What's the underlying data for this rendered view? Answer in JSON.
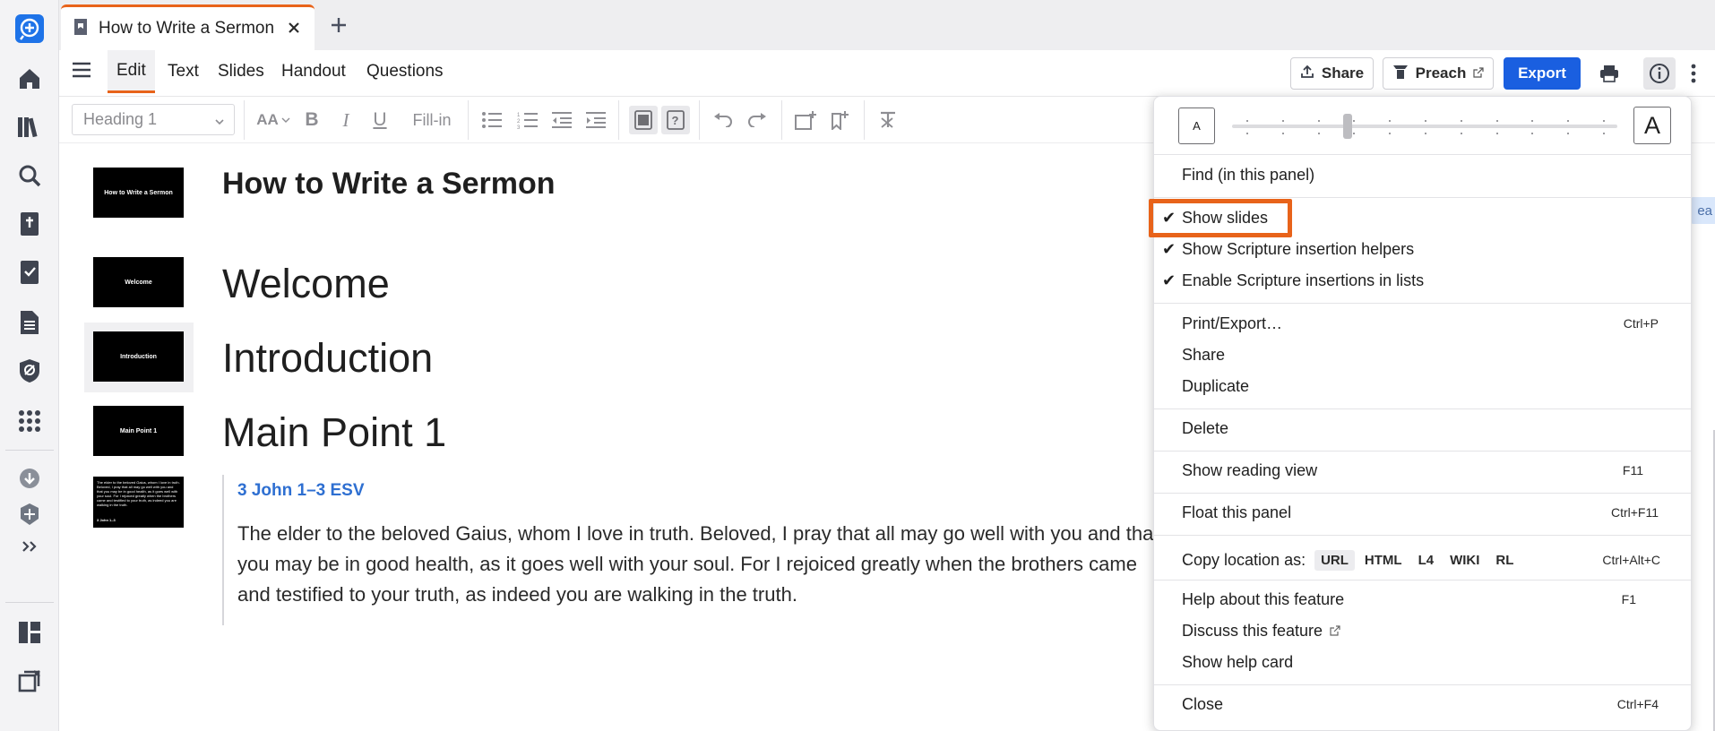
{
  "tab": {
    "title": "How to Write a Sermon"
  },
  "menubar": {
    "tabs": [
      "Edit",
      "Text",
      "Slides",
      "Handout",
      "Questions"
    ],
    "active_tab": "Edit",
    "share_label": "Share",
    "preach_label": "Preach",
    "export_label": "Export"
  },
  "format_toolbar": {
    "style_value": "Heading 1",
    "fill_in_label": "Fill-in",
    "font_size_glyph": "AA"
  },
  "document": {
    "slides": [
      {
        "thumb_text": "How to Write a Sermon",
        "heading": "How to Write a Sermon",
        "level": "title"
      },
      {
        "thumb_text": "Welcome",
        "heading": "Welcome",
        "level": "h1"
      },
      {
        "thumb_text": "Introduction",
        "heading": "Introduction",
        "level": "h1"
      },
      {
        "thumb_text": "Main Point 1",
        "heading": "Main Point 1",
        "level": "h1"
      }
    ],
    "scripture": {
      "reference": "3 John 1–3 ESV",
      "text": "The elder to the beloved Gaius, whom I love in truth. Beloved, I pray that all may go well with you and that you may be in good health, as it goes well with your soul. For I rejoiced greatly when the brothers came and testified to your truth, as indeed you are walking in the truth.",
      "thumb_ref": "3 John 1–3"
    }
  },
  "panel": {
    "font_size": {
      "small_label": "A",
      "large_label": "A",
      "level": 0.3
    },
    "find_label": "Find (in this panel)",
    "toggles": [
      {
        "label": "Show slides",
        "checked": true,
        "highlighted": true
      },
      {
        "label": "Show Scripture insertion helpers",
        "checked": true
      },
      {
        "label": "Enable Scripture insertions in lists",
        "checked": true
      }
    ],
    "actions_1": [
      {
        "label": "Print/Export…",
        "shortcut": "Ctrl+P"
      },
      {
        "label": "Share",
        "shortcut": ""
      },
      {
        "label": "Duplicate",
        "shortcut": ""
      }
    ],
    "delete_label": "Delete",
    "reading_view": {
      "label": "Show reading view",
      "shortcut": "F11"
    },
    "float_panel": {
      "label": "Float this panel",
      "shortcut": "Ctrl+F11"
    },
    "copy_location": {
      "label": "Copy location as:",
      "formats": [
        "URL",
        "HTML",
        "L4",
        "WIKI",
        "RL"
      ],
      "selected": "URL",
      "shortcut": "Ctrl+Alt+C"
    },
    "help": [
      {
        "label": "Help about this feature",
        "shortcut": "F1"
      },
      {
        "label": "Discuss this feature",
        "shortcut": ""
      },
      {
        "label": "Show help card",
        "shortcut": ""
      }
    ],
    "close": {
      "label": "Close",
      "shortcut": "Ctrl+F4"
    }
  },
  "edge_chip_text": "ea",
  "colors": {
    "accent_orange": "#e8631a",
    "primary_blue": "#1a5fe0",
    "link_blue": "#2e6fd1",
    "logos_blue": "#1e73e8"
  },
  "icons": {
    "rail": [
      "logos-add-icon",
      "home-icon",
      "library-icon",
      "search-icon",
      "bible-icon",
      "checklist-icon",
      "document-icon",
      "shield-icon",
      "apps-grid-icon",
      "download-icon",
      "cube-shield-icon",
      "expand-chevrons-icon",
      "layout-icon",
      "close-panels-icon"
    ]
  }
}
